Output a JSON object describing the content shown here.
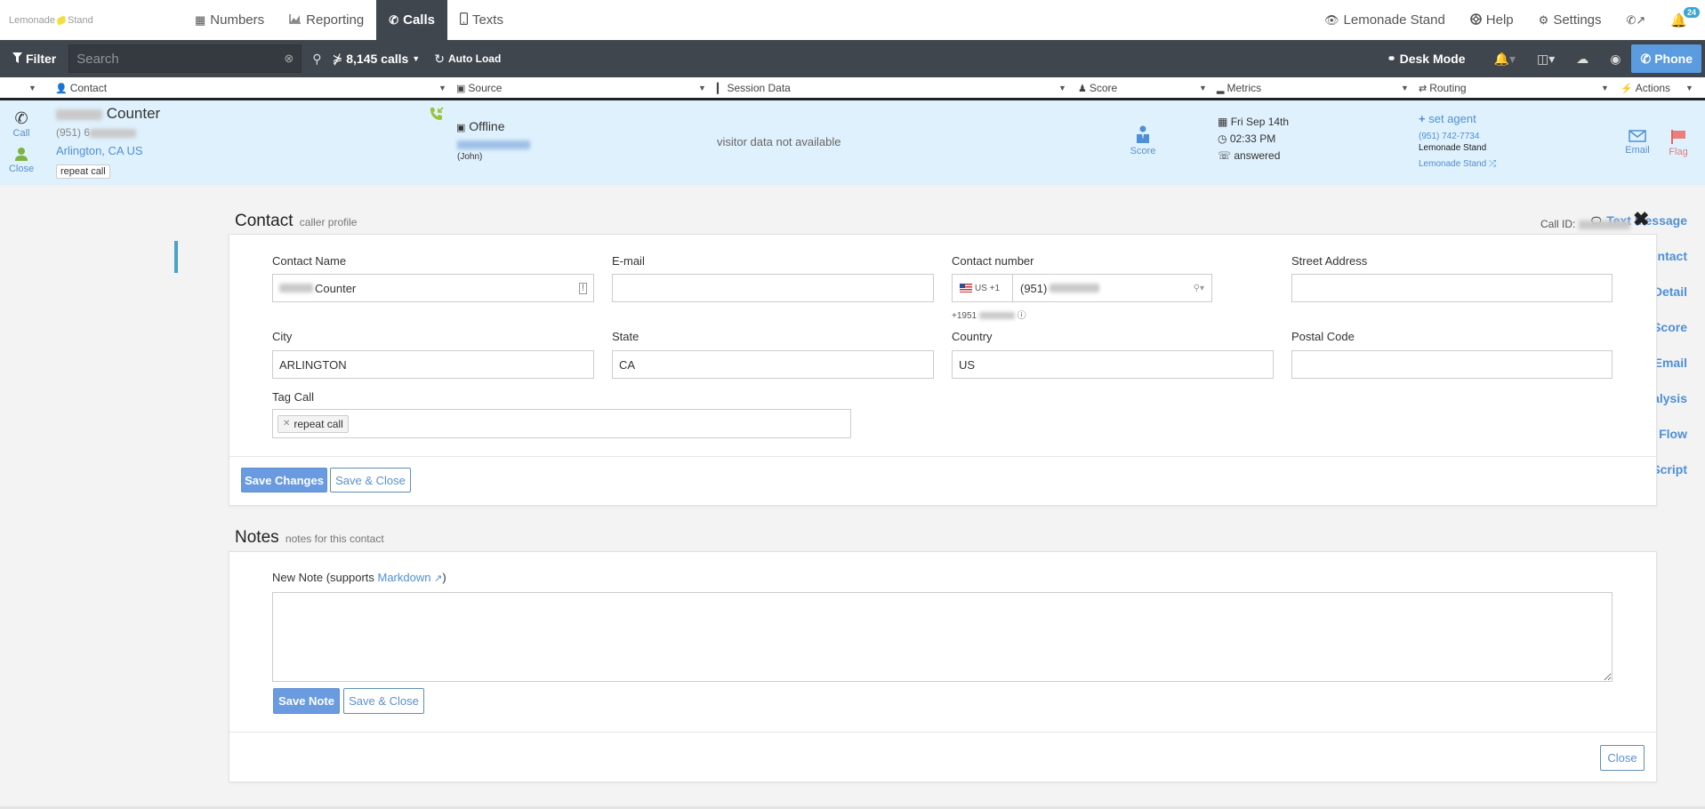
{
  "app": {
    "logo_left": "Lemonade",
    "logo_right": "Stand"
  },
  "topnav": {
    "tabs": [
      {
        "label": "Numbers",
        "icon": "grid-icon",
        "active": false
      },
      {
        "label": "Reporting",
        "icon": "area-chart-icon",
        "active": false
      },
      {
        "label": "Calls",
        "icon": "phone-icon",
        "active": true
      },
      {
        "label": "Texts",
        "icon": "mobile-icon",
        "active": false
      }
    ],
    "account_label": "Lemonade Stand",
    "help_label": "Help",
    "settings_label": "Settings",
    "notification_count": "24"
  },
  "toolbar": {
    "filter_label": "Filter",
    "search_placeholder": "Search",
    "call_count_label": "8,145 calls",
    "auto_load_label": "Auto Load",
    "desk_mode_label": "Desk Mode",
    "phone_label": "Phone"
  },
  "columns": {
    "contact": "Contact",
    "source": "Source",
    "session_data": "Session Data",
    "score": "Score",
    "metrics": "Metrics",
    "routing": "Routing",
    "actions": "Actions"
  },
  "call_row": {
    "call_label": "Call",
    "close_label": "Close",
    "contact_name_suffix": "Counter",
    "contact_phone_prefix": "(951) 6",
    "location": "Arlington, CA US",
    "tag": "repeat call",
    "source_name": "Offline",
    "source_owner": "(John)",
    "session_text": "visitor data not available",
    "score_label": "Score",
    "date": "Fri Sep 14th",
    "time": "02:33 PM",
    "status": "answered",
    "set_agent_label": "set agent",
    "routing_number": "(951) 742-7734",
    "routing_name": "Lemonade Stand",
    "routing_link": "Lemonade Stand",
    "email_label": "Email",
    "flag_label": "Flag"
  },
  "sidemenu": {
    "items": [
      {
        "label": "Text Message",
        "icon": "comment-icon"
      },
      {
        "label": "Contact",
        "icon": "user-icon",
        "active": true
      },
      {
        "label": "Visitor Detail",
        "icon": "bar-chart-icon"
      },
      {
        "label": "Score",
        "icon": "score-icon"
      },
      {
        "label": "Email",
        "icon": "envelope-icon"
      },
      {
        "label": "Voice Analysis",
        "icon": "play-circle-icon"
      },
      {
        "label": "Call Flow",
        "icon": "phone-icon"
      },
      {
        "label": "Script",
        "icon": "document-icon"
      }
    ]
  },
  "contact_section": {
    "title": "Contact",
    "subtitle": "caller profile",
    "call_id_label": "Call ID:",
    "fields": {
      "contact_name": {
        "label": "Contact Name",
        "value_suffix": "Counter"
      },
      "email": {
        "label": "E-mail",
        "value": ""
      },
      "contact_number": {
        "label": "Contact number",
        "country": "US +1",
        "value_prefix": "(951)",
        "formatted_prefix": "+1951"
      },
      "street_address": {
        "label": "Street Address",
        "value": ""
      },
      "city": {
        "label": "City",
        "value": "ARLINGTON"
      },
      "state": {
        "label": "State",
        "value": "CA"
      },
      "country": {
        "label": "Country",
        "value": "US"
      },
      "postal_code": {
        "label": "Postal Code",
        "value": ""
      },
      "tag_call": {
        "label": "Tag Call",
        "tags": [
          "repeat call"
        ]
      }
    },
    "save_changes_label": "Save Changes",
    "save_close_label": "Save & Close"
  },
  "notes_section": {
    "title": "Notes",
    "subtitle": "notes for this contact",
    "new_note_label_pre": "New Note (supports ",
    "markdown_link": "Markdown",
    "new_note_label_post": ")",
    "note_value": "",
    "save_note_label": "Save Note",
    "save_close_label": "Save & Close",
    "close_label": "Close"
  }
}
